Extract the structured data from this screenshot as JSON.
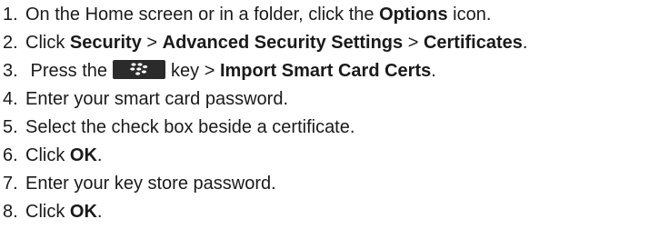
{
  "steps": [
    {
      "num": "1.",
      "pre": "On the Home screen or in a folder, click the ",
      "b1": "Options",
      "post": " icon."
    },
    {
      "num": "2.",
      "pre": "Click ",
      "b1": "Security",
      "sep1": " > ",
      "b2": "Advanced Security Settings",
      "sep2": " > ",
      "b3": "Certificates",
      "post": "."
    },
    {
      "num": "3.",
      "pre": " Press the",
      "icon": "blackberry-menu-key-icon",
      "mid": "key > ",
      "b1": "Import Smart Card Certs",
      "post": "."
    },
    {
      "num": "4.",
      "text": "Enter your smart card password."
    },
    {
      "num": "5.",
      "text": "Select the check box beside a certificate."
    },
    {
      "num": "6.",
      "pre": "Click ",
      "b1": "OK",
      "post": "."
    },
    {
      "num": "7.",
      "text": "Enter your key store password."
    },
    {
      "num": "8.",
      "pre": "Click ",
      "b1": "OK",
      "post": "."
    }
  ],
  "colors": {
    "text": "#1a1a1a",
    "key_background": "#2b2b2b",
    "key_symbol": "#ffffff"
  }
}
